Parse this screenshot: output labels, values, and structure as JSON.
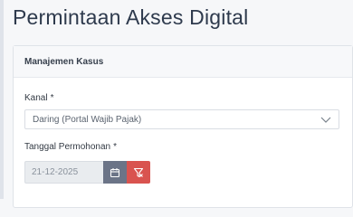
{
  "page": {
    "title": "Permintaan Akses Digital"
  },
  "card": {
    "header": "Manajemen Kasus"
  },
  "form": {
    "kanal": {
      "label": "Kanal",
      "required_mark": "*",
      "value": "Daring (Portal Wajib Pajak)"
    },
    "tanggal": {
      "label": "Tanggal Permohonan",
      "required_mark": "*",
      "value": "21-12-2025"
    }
  },
  "icons": {
    "dropdown": "chevron-down-icon",
    "calendar": "calendar-icon",
    "clear": "filter-clear-icon"
  },
  "colors": {
    "calendar_button": "#6b7487",
    "clear_button": "#d9534f",
    "title": "#2e3a4d"
  }
}
